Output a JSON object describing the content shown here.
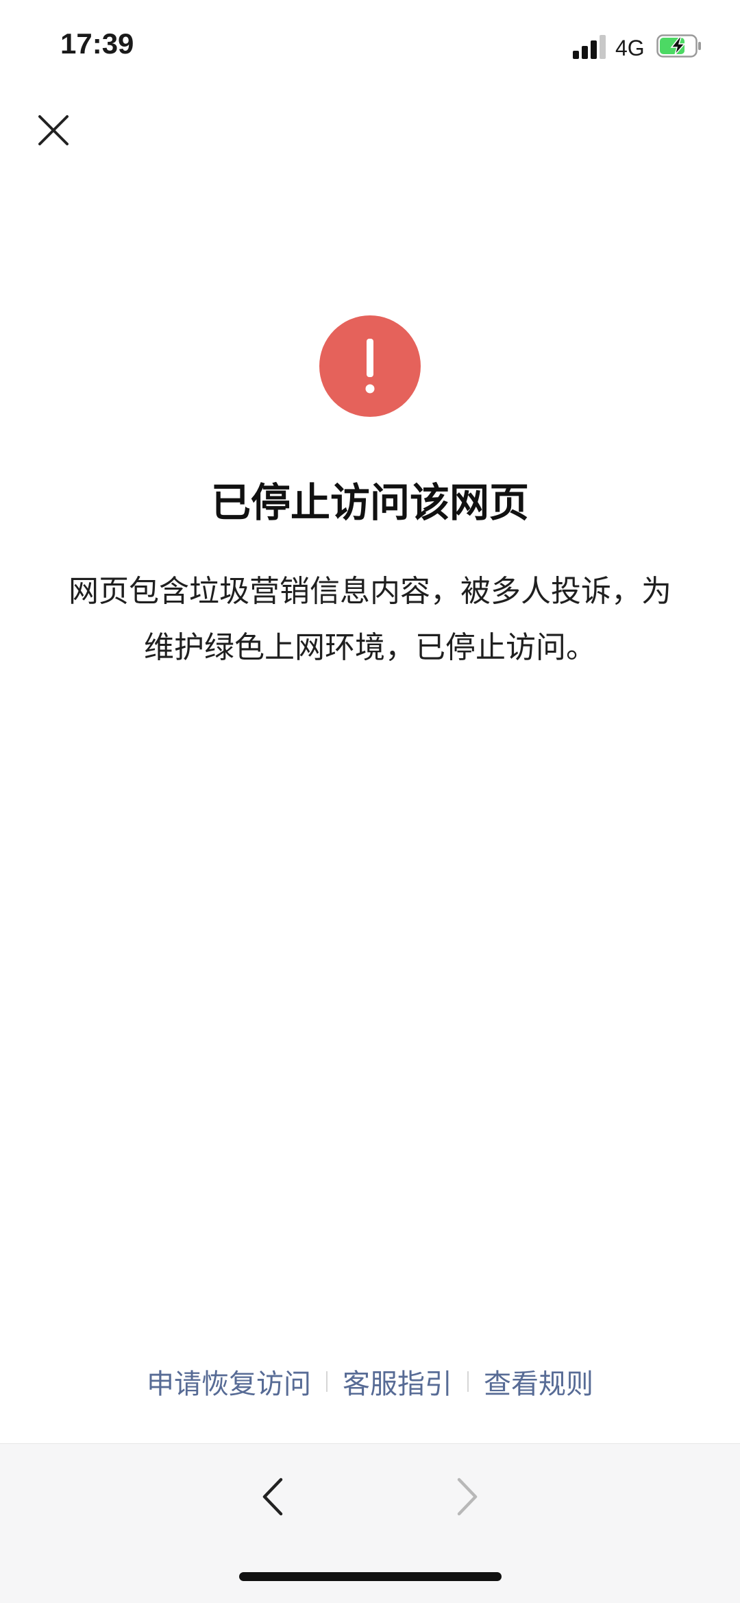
{
  "status_bar": {
    "time": "17:39",
    "network": "4G"
  },
  "header": {
    "close_icon": "close-icon"
  },
  "message": {
    "icon": "exclamation-circle-icon",
    "icon_color": "#e5625b",
    "title": "已停止访问该网页",
    "description": "网页包含垃圾营销信息内容，被多人投诉，为维护绿色上网环境，已停止访问。"
  },
  "footer_links": [
    {
      "label": "申请恢复访问"
    },
    {
      "label": "客服指引"
    },
    {
      "label": "查看规则"
    }
  ],
  "toolbar": {
    "back_icon": "chevron-left-icon",
    "forward_icon": "chevron-right-icon"
  },
  "colors": {
    "link": "#576b95",
    "warning": "#e5625b",
    "toolbar_bg": "#f6f6f7"
  }
}
